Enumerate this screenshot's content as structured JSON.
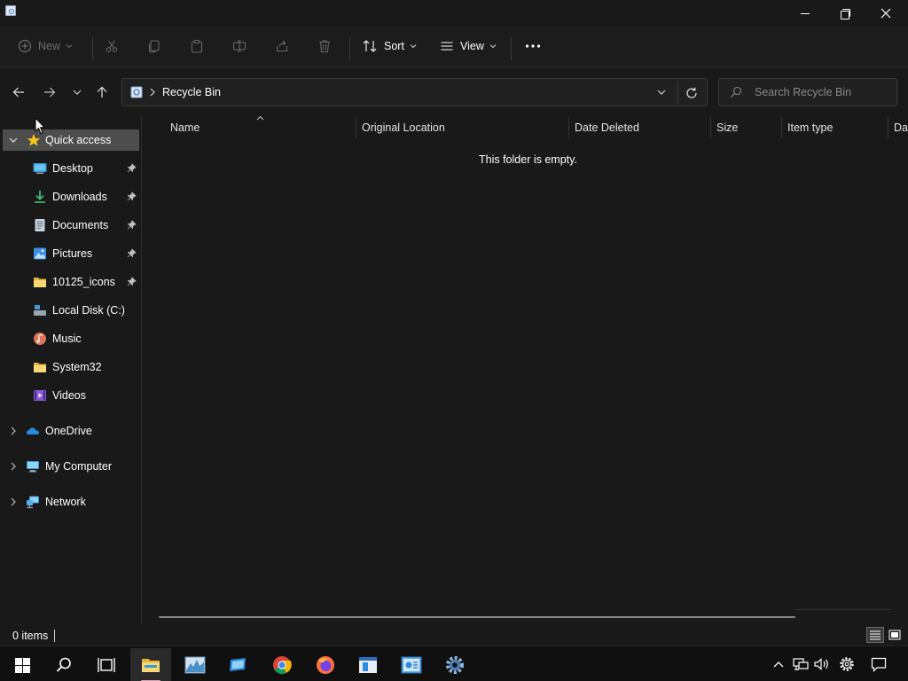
{
  "window": {
    "title_icon": "recycle-bin-icon"
  },
  "commandbar": {
    "new_label": "New",
    "sort_label": "Sort",
    "view_label": "View"
  },
  "address": {
    "location": "Recycle Bin"
  },
  "search": {
    "placeholder": "Search Recycle Bin"
  },
  "navpane": {
    "quick_access": "Quick access",
    "items": [
      {
        "label": "Desktop",
        "icon": "desktop-icon",
        "pinned": true
      },
      {
        "label": "Downloads",
        "icon": "downloads-icon",
        "pinned": true
      },
      {
        "label": "Documents",
        "icon": "documents-icon",
        "pinned": true
      },
      {
        "label": "Pictures",
        "icon": "pictures-icon",
        "pinned": true
      },
      {
        "label": "10125_icons",
        "icon": "folder-icon",
        "pinned": true
      },
      {
        "label": "Local Disk (C:)",
        "icon": "local-disk-icon",
        "pinned": false
      },
      {
        "label": "Music",
        "icon": "music-icon",
        "pinned": false
      },
      {
        "label": "System32",
        "icon": "folder-icon",
        "pinned": false
      },
      {
        "label": "Videos",
        "icon": "videos-icon",
        "pinned": false
      }
    ],
    "roots": [
      {
        "label": "OneDrive",
        "icon": "onedrive-icon"
      },
      {
        "label": "My Computer",
        "icon": "computer-icon"
      },
      {
        "label": "Network",
        "icon": "network-icon"
      }
    ]
  },
  "columns": [
    "Name",
    "Original Location",
    "Date Deleted",
    "Size",
    "Item type",
    "Dat"
  ],
  "content": {
    "empty_message": "This folder is empty."
  },
  "status": {
    "items_count": "0 items"
  },
  "taskbar": {
    "apps": [
      "start-icon",
      "search-icon",
      "task-view-icon",
      "file-explorer-icon",
      "resource-monitor-icon",
      "app-icon",
      "chrome-icon",
      "firefox-icon",
      "notepad-icon",
      "control-panel-icon",
      "settings-icon"
    ],
    "tray": [
      "chevron-up-icon",
      "network-icon",
      "volume-icon",
      "settings-icon",
      "notification-icon"
    ]
  },
  "colors": {
    "background": "#191919",
    "selected": "#4d4d4d",
    "accent_yellow": "#f5c518",
    "folder_yellow": "#f8d775"
  }
}
